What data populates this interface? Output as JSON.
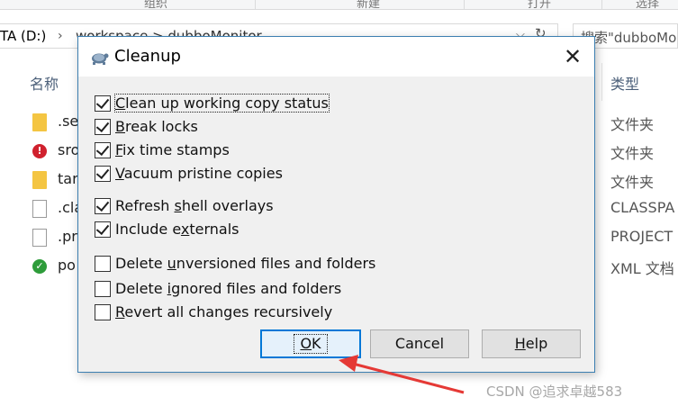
{
  "explorer": {
    "ribbon": {
      "group1": "组织",
      "group2": "新建",
      "group3": "打开",
      "group4": "选择"
    },
    "address": {
      "drive": "TA (D:)",
      "path": "workspace > dubboMonitor"
    },
    "search_placeholder": "搜索\"dubboMo",
    "columns": {
      "name": "名称",
      "type": "类型"
    },
    "files": [
      {
        "name": ".se",
        "type": "文件夹",
        "icon": "folder-icon"
      },
      {
        "name": "sro",
        "type": "文件夹",
        "icon": "conflict-folder-icon"
      },
      {
        "name": "tar",
        "type": "文件夹",
        "icon": "folder-icon"
      },
      {
        "name": ".cla",
        "type": "CLASSPA",
        "icon": "document-icon"
      },
      {
        "name": ".pr",
        "type": "PROJECT",
        "icon": "document-icon"
      },
      {
        "name": "po",
        "type": "XML 文档",
        "icon": "versioned-file-icon"
      }
    ],
    "watermark": "CSDN @追求卓越583"
  },
  "dialog": {
    "title": "Cleanup",
    "options": [
      {
        "pre": "",
        "key": "C",
        "post": "lean up working copy status",
        "checked": true
      },
      {
        "pre": "",
        "key": "B",
        "post": "reak locks",
        "checked": true
      },
      {
        "pre": "",
        "key": "F",
        "post": "ix time stamps",
        "checked": true
      },
      {
        "pre": "",
        "key": "V",
        "post": "acuum pristine copies",
        "checked": true
      },
      {
        "pre": "Refresh ",
        "key": "s",
        "post": "hell overlays",
        "checked": true
      },
      {
        "pre": "Include e",
        "key": "x",
        "post": "ternals",
        "checked": true
      },
      {
        "pre": "Delete ",
        "key": "u",
        "post": "nversioned files and folders",
        "checked": false
      },
      {
        "pre": "Delete ",
        "key": "i",
        "post": "gnored files and folders",
        "checked": false
      },
      {
        "pre": "",
        "key": "R",
        "post": "evert all changes recursively",
        "checked": false
      }
    ],
    "buttons": {
      "ok_key": "O",
      "ok_rest": "K",
      "cancel": "Cancel",
      "help_key": "H",
      "help_rest": "elp"
    }
  },
  "colors": {
    "dialog_border": "#3c7fb1",
    "default_button_border": "#0078d7",
    "annotation_arrow": "#e53935"
  }
}
